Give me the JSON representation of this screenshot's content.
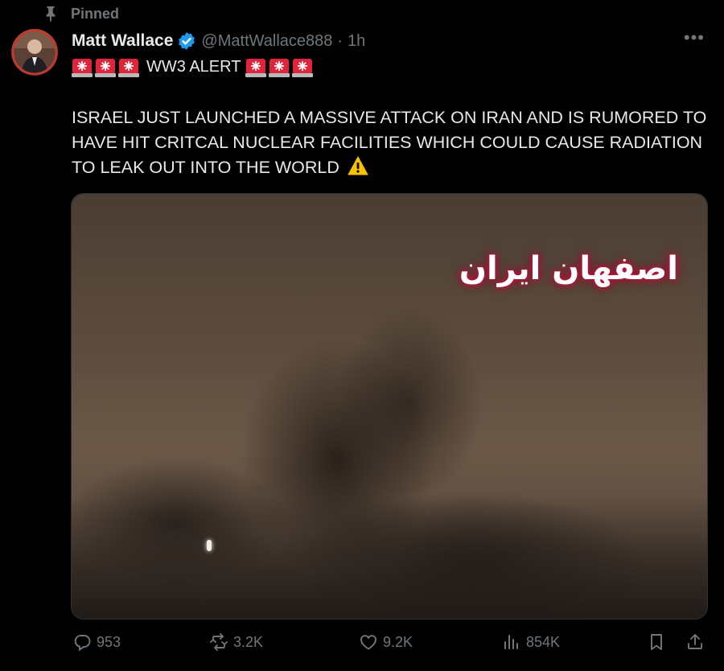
{
  "pinned": {
    "label": "Pinned",
    "icon": "pin-icon"
  },
  "author": {
    "name": "Matt Wallace",
    "handle": "@MattWallace888",
    "separator": "·",
    "time": "1h",
    "verified_color": "#1d9bf0"
  },
  "tweet": {
    "alert_text": "WW3 ALERT",
    "body": "ISRAEL JUST LAUNCHED A MASSIVE ATTACK ON IRAN AND IS RUMORED TO HAVE HIT CRITCAL NUCLEAR FACILITIES WHICH COULD CAUSE RADIATION TO LEAK OUT INTO THE WORLD"
  },
  "media": {
    "overlay_text": "اصفهان ایران"
  },
  "actions": {
    "replies": "953",
    "retweets": "3.2K",
    "likes": "9.2K",
    "views": "854K"
  },
  "colors": {
    "background": "#000000",
    "text": "#e7e9ea",
    "muted": "#71767b",
    "siren": "#e0243b"
  }
}
